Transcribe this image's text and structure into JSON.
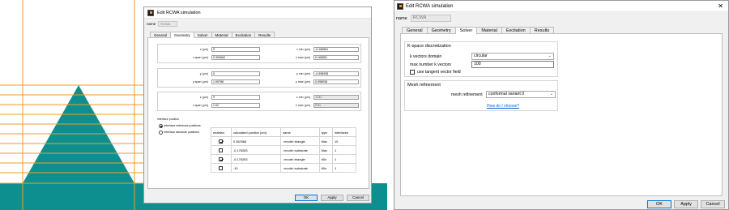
{
  "colors": {
    "substrate": "#0e8f8f",
    "mesh_lines": "#f39a2e",
    "accent": "#0078d7",
    "link": "#0066cc"
  },
  "small_dialog": {
    "title": "Edit RCWA simulation",
    "name_label": "name",
    "name_value": "RCWA",
    "tabs": [
      "General",
      "Geometry",
      "Solver",
      "Material",
      "Excitation",
      "Results"
    ],
    "active_tab": "Geometry",
    "geometry": {
      "x_label": "x (µm)",
      "x_value": "0",
      "x_span_label": "x span (µm)",
      "x_span_value": "0.353662",
      "x_min_label": "x min (µm)",
      "x_min_value": "-0.165551",
      "x_max_label": "x max (µm)",
      "x_max_value": "0.165551",
      "y_label": "y (µm)",
      "y_value": "0",
      "y_span_label": "y span (µm)",
      "y_span_value": "1.99788",
      "y_min_label": "y min (µm)",
      "y_min_value": "-0.998938",
      "y_max_label": "y max (µm)",
      "y_max_value": "0.998938",
      "z_label": "z (µm)",
      "z_value": "0",
      "z_span_label": "z span (µm)",
      "z_span_value": "1.02",
      "z_min_label": "z min (µm)",
      "z_min_value": "-0.51",
      "z_max_label": "z max (µm)",
      "z_max_value": "0.51"
    },
    "interface_position": {
      "title": "interface position",
      "options": [
        "interface reference positions",
        "interface absolute positions"
      ],
      "selected": 0
    },
    "interfaces_table": {
      "columns": [
        "enabled",
        "calculated position (um)",
        "name",
        "type",
        "interfaces"
      ],
      "rows": [
        {
          "enabled": true,
          "position": "0.352566",
          "name": "::model::triangle",
          "type": "Max",
          "interfaces": "10"
        },
        {
          "enabled": false,
          "position": "-0.176283",
          "name": "::model::substrate",
          "type": "Max",
          "interfaces": "1"
        },
        {
          "enabled": true,
          "position": "-0.176283",
          "name": "::model::triangle",
          "type": "Min",
          "interfaces": "1"
        },
        {
          "enabled": false,
          "position": "-10",
          "name": "::model::substrate",
          "type": "Min",
          "interfaces": "1"
        }
      ]
    },
    "buttons": {
      "ok": "OK",
      "apply": "Apply",
      "cancel": "Cancel"
    }
  },
  "large_dialog": {
    "title": "Edit RCWA simulation",
    "window_buttons": {
      "close": "✕"
    },
    "name_label": "name",
    "name_value": "RCWA",
    "tabs": [
      "General",
      "Geometry",
      "Solver",
      "Material",
      "Excitation",
      "Results"
    ],
    "active_tab": "Solver",
    "kspace": {
      "title": "K-space discretization",
      "k_vectors_domain_label": "k vectors domain",
      "k_vectors_domain_value": "circular",
      "max_k_vectors_label": "max number k vectors",
      "max_k_vectors_value": "100",
      "use_tangent_vector_field_label": "use tangent vector field",
      "use_tangent_vector_field": false
    },
    "mesh": {
      "title": "Mesh refinement",
      "mesh_refinement_label": "mesh refinement",
      "mesh_refinement_value": "conformal variant 0",
      "help_link": "How do I choose?"
    },
    "buttons": {
      "ok": "OK",
      "apply": "Apply",
      "cancel": "Cancel"
    }
  }
}
